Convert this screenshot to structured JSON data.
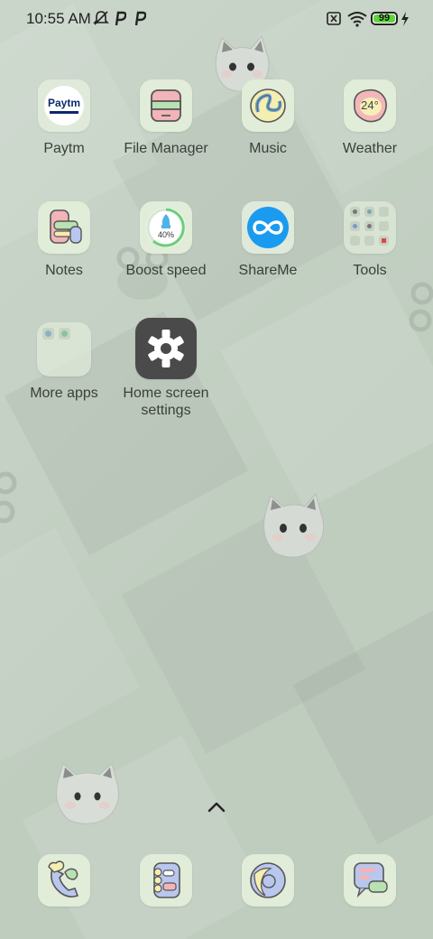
{
  "status_bar": {
    "time": "10:55 AM",
    "battery_level": "99",
    "icons": [
      "bell-off-icon",
      "p-notification-icon",
      "p-notification-icon",
      "sim-off-icon",
      "wifi-icon",
      "battery-icon",
      "charging-icon"
    ]
  },
  "apps": [
    {
      "name": "Paytm",
      "icon": "paytm-icon"
    },
    {
      "name": "File Manager",
      "icon": "file-manager-icon"
    },
    {
      "name": "Music",
      "icon": "music-icon"
    },
    {
      "name": "Weather",
      "icon": "weather-icon",
      "badge": "24°"
    },
    {
      "name": "Notes",
      "icon": "notes-icon"
    },
    {
      "name": "Boost speed",
      "icon": "boost-speed-icon",
      "badge": "40%"
    },
    {
      "name": "ShareMe",
      "icon": "shareme-icon"
    },
    {
      "name": "Tools",
      "icon": "folder-icon"
    },
    {
      "name": "More apps",
      "icon": "folder-icon"
    },
    {
      "name": "Home screen settings",
      "icon": "gear-icon"
    }
  ],
  "dock": [
    {
      "name": "Phone",
      "icon": "phone-icon"
    },
    {
      "name": "Contacts",
      "icon": "contacts-icon"
    },
    {
      "name": "Browser",
      "icon": "browser-icon"
    },
    {
      "name": "Messages",
      "icon": "messages-icon"
    }
  ]
}
